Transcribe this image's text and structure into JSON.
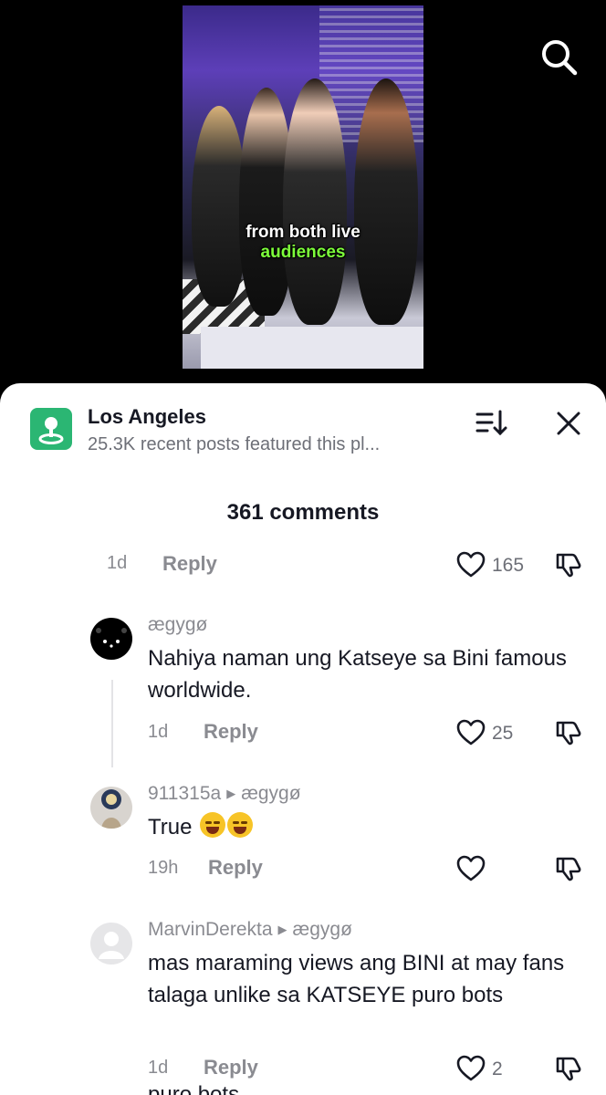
{
  "video": {
    "caption_line1": "from both live",
    "caption_line2": "audiences"
  },
  "header": {
    "place_title": "Los Angeles",
    "place_subtitle": "25.3K recent posts featured this pl...",
    "comment_count": "361 comments"
  },
  "parent_comment_footer": {
    "time": "1d",
    "reply_label": "Reply",
    "likes": "165"
  },
  "comments": [
    {
      "user": "ægygø",
      "reply_to": "",
      "text": "Nahiya naman ung Katseye sa Bini famous worldwide.",
      "time": "1d",
      "reply_label": "Reply",
      "likes": "25"
    },
    {
      "user": "911315a",
      "reply_to": "ægygø",
      "text": "True",
      "time": "19h",
      "reply_label": "Reply",
      "likes": ""
    },
    {
      "user": "MarvinDerekta",
      "reply_to": "ægygø",
      "text": "mas maraming views ang BINI at may fans talaga unlike sa KATSEYE puro bots",
      "time": "1d",
      "reply_label": "Reply",
      "likes": "2"
    }
  ],
  "truncated_next_line": "puro bots",
  "colors": {
    "place_icon_bg": "#2bb673",
    "caption_highlight": "#7dff3a",
    "secondary_text": "#8a8b91"
  },
  "icons": [
    "search-icon",
    "location-pin-icon",
    "sort-icon",
    "close-icon",
    "heart-icon",
    "dislike-icon"
  ]
}
